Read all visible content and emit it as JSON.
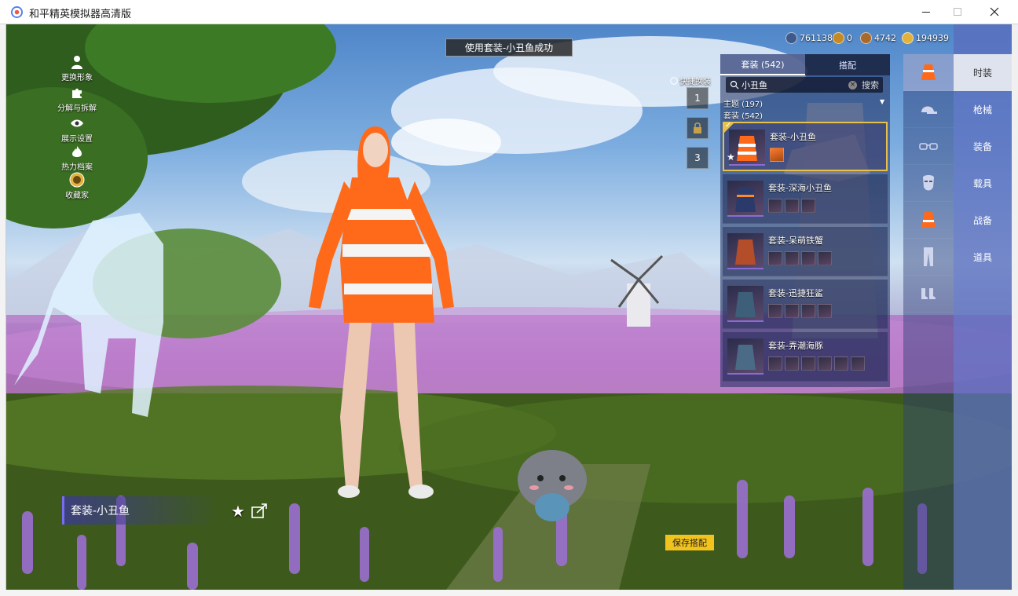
{
  "window": {
    "title": "和平精英模拟器高清版"
  },
  "left_menu": [
    {
      "label": "更换形象",
      "icon": "person-icon"
    },
    {
      "label": "分解与拆解",
      "icon": "puzzle-icon"
    },
    {
      "label": "展示设置",
      "icon": "eye-icon"
    },
    {
      "label": "热力档案",
      "icon": "flame-icon"
    },
    {
      "label": "收藏家",
      "icon": "collector-badge-icon"
    }
  ],
  "toast": "使用套装-小丑鱼成功",
  "currency": [
    {
      "value": "761138",
      "icon": "coin-blue-icon",
      "color": "#3d5a8a"
    },
    {
      "value": "0",
      "icon": "coin-gold-icon",
      "color": "#c58b22"
    },
    {
      "value": "4742",
      "icon": "coin-bronze-icon",
      "color": "#a86a2a"
    },
    {
      "value": "194939",
      "icon": "coin-yellow-icon",
      "color": "#e2b23a"
    }
  ],
  "quick_change": {
    "label": "快捷换装",
    "slots": [
      "1",
      "",
      "3"
    ]
  },
  "panel": {
    "tabs": [
      {
        "label": "套装 (542)",
        "active": true
      },
      {
        "label": "搭配",
        "active": false
      }
    ],
    "search": {
      "value": "小丑鱼",
      "button": "搜索"
    },
    "filters": [
      "主题 (197)",
      "套装 (542)"
    ],
    "outfits": [
      {
        "name": "套装-小丑鱼",
        "selected": true,
        "item_count": 1
      },
      {
        "name": "套装-深海小丑鱼",
        "selected": false,
        "item_count": 3
      },
      {
        "name": "套装-呆萌铁蟹",
        "selected": false,
        "item_count": 4
      },
      {
        "name": "套装-迅捷狂鲨",
        "selected": false,
        "item_count": 4
      },
      {
        "name": "套装-弄潮海豚",
        "selected": false,
        "item_count": 6
      }
    ]
  },
  "icon_column": [
    {
      "icon": "outfit-icon",
      "active": true
    },
    {
      "icon": "cap-icon",
      "active": false
    },
    {
      "icon": "glasses-icon",
      "active": false
    },
    {
      "icon": "mask-icon",
      "active": false
    },
    {
      "icon": "top-icon",
      "active": false
    },
    {
      "icon": "pants-icon",
      "active": false
    },
    {
      "icon": "shoes-icon",
      "active": false
    }
  ],
  "categories": [
    {
      "label": "时装",
      "active": true
    },
    {
      "label": "枪械",
      "active": false
    },
    {
      "label": "装备",
      "active": false
    },
    {
      "label": "载具",
      "active": false
    },
    {
      "label": "战备",
      "active": false
    },
    {
      "label": "道具",
      "active": false
    }
  ],
  "current_outfit_name": "套装-小丑鱼",
  "save_button": "保存搭配",
  "colors": {
    "accent_gold": "#f2c21d",
    "selected_border": "#e8c14a",
    "category_bg": "#5a6ebe"
  }
}
